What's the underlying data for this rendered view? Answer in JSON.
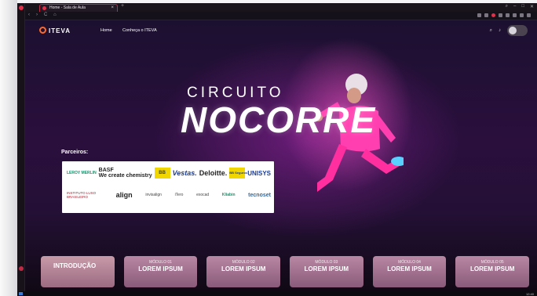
{
  "browser": {
    "tab_title": "Home - Sala de Aula",
    "new_tab": "+",
    "tab_close": "×",
    "nav_back": "‹",
    "nav_forward": "›",
    "nav_reload": "C"
  },
  "site": {
    "logo": "ITEVA",
    "nav": {
      "home": "Home",
      "about": "Conheça o ITEVA"
    }
  },
  "hero": {
    "subtitle": "CIRCUITO",
    "title": "NOCORRE"
  },
  "partners": {
    "label": "Parceiros:",
    "row1": [
      "LEROY MERLIN",
      "BASF",
      "BB",
      "Vestas.",
      "Deloitte.",
      "BB Seguros",
      "UNISYS"
    ],
    "row1_basf_tag": "We create chemistry",
    "row2": [
      "INSTITUTO LUSO BRASILEIRO",
      "align",
      "invisalign",
      "iTero",
      "exocad",
      "Kliabin",
      "tecnoset"
    ]
  },
  "modules": [
    {
      "num": "",
      "title": "INTRODUÇÃO"
    },
    {
      "num": "MÓDULO 01",
      "title": "LOREM IPSUM"
    },
    {
      "num": "MÓDULO 02",
      "title": "LOREM IPSUM"
    },
    {
      "num": "MÓDULO 03",
      "title": "LOREM IPSUM"
    },
    {
      "num": "MÓDULO 04",
      "title": "LOREM IPSUM"
    },
    {
      "num": "MÓDULO 05",
      "title": "LOREM IPSUM"
    }
  ],
  "taskbar": {
    "time": "12:40"
  },
  "colors": {
    "accent": "#e0304a",
    "hero_bg": "#2a0f3d",
    "logo_orange": "#ff6a2a"
  }
}
